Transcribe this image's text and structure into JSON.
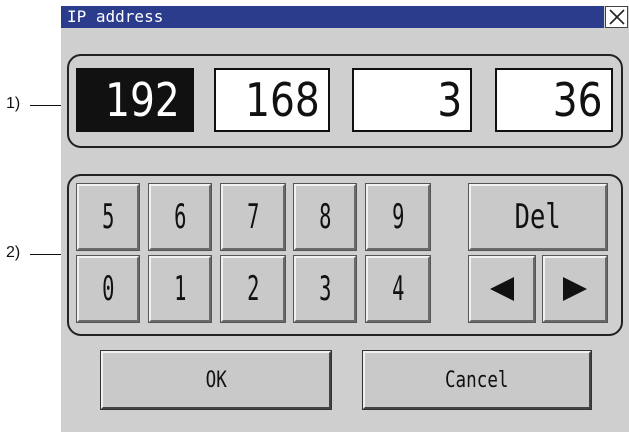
{
  "window": {
    "title": "IP address"
  },
  "callouts": {
    "ip_fields": "1)",
    "keypad": "2)"
  },
  "ip_address": {
    "octets": [
      "192",
      "168",
      "3",
      "36"
    ],
    "selected_index": 0
  },
  "keypad": {
    "row1": [
      "5",
      "6",
      "7",
      "8",
      "9"
    ],
    "row2": [
      "0",
      "1",
      "2",
      "3",
      "4"
    ],
    "delete_label": "Del",
    "left_icon": "left-arrow-icon",
    "right_icon": "right-arrow-icon"
  },
  "buttons": {
    "ok": "OK",
    "cancel": "Cancel"
  },
  "colors": {
    "titlebar": "#2c3c8c",
    "background": "#cfcfcf",
    "selected": "#111111"
  }
}
